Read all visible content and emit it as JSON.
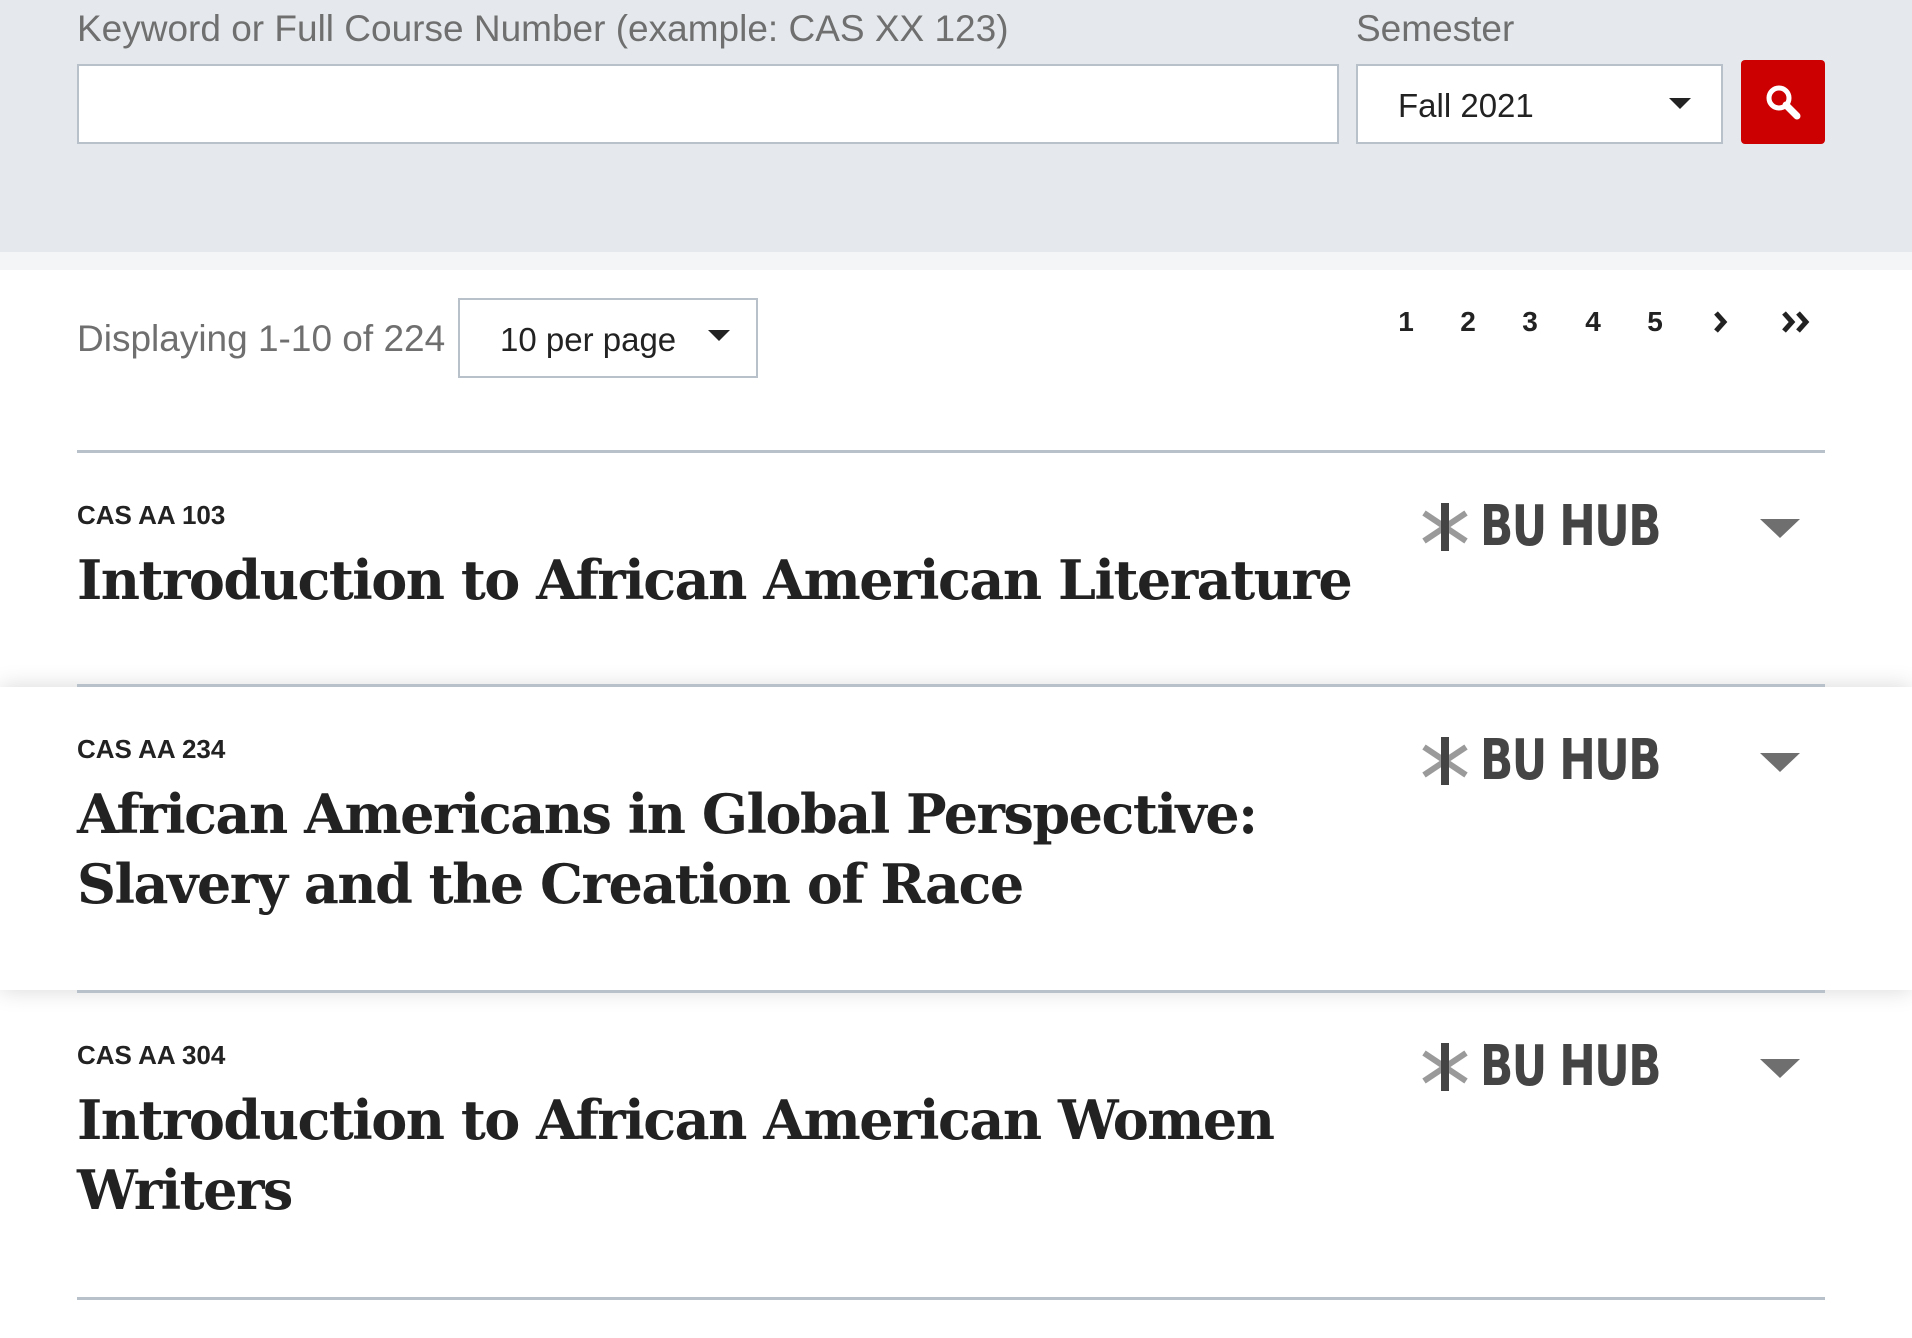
{
  "search": {
    "keyword_label": "Keyword or Full Course Number (example: CAS XX 123)",
    "keyword_value": "",
    "semester_label": "Semester",
    "semester_value": "Fall 2021"
  },
  "results": {
    "displaying": "Displaying 1-10 of 224",
    "per_page": "10 per page"
  },
  "pagination": {
    "pages": [
      "1",
      "2",
      "3",
      "4",
      "5"
    ],
    "next": "›",
    "last": "»"
  },
  "hub_label": "BU HUB",
  "courses": [
    {
      "number": "CAS AA 103",
      "title": "Introduction to African American Literature"
    },
    {
      "number": "CAS AA 234",
      "title": "African Americans in Global Perspective: Slavery and the Creation of Race"
    },
    {
      "number": "CAS AA 304",
      "title": "Introduction to African American Women Writers"
    }
  ],
  "colors": {
    "panel_bg": "#e5e9ed",
    "accent_red": "#cc0000",
    "divider": "#b8c1ca",
    "muted_text": "#6f6f6f"
  }
}
